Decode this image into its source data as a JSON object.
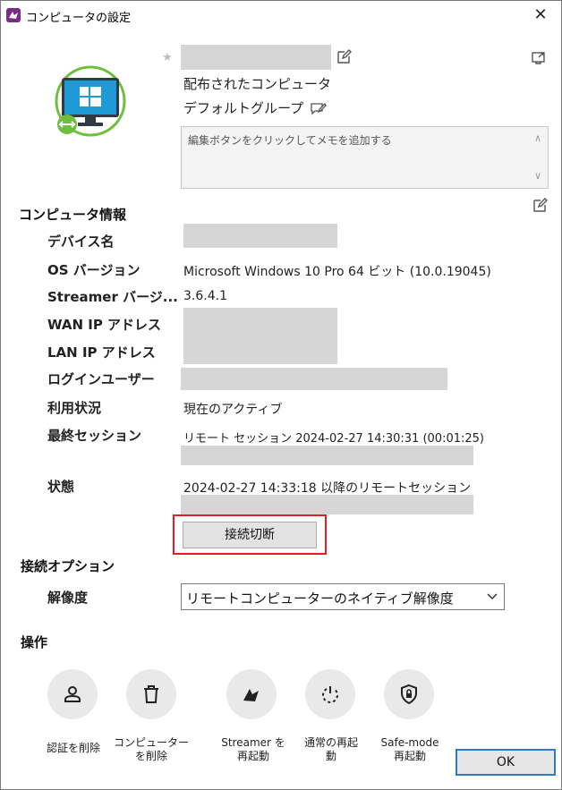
{
  "window": {
    "title": "コンピュータの設定",
    "close_glyph": "✕"
  },
  "header": {
    "star_glyph": "★",
    "distributed_label": "配布されたコンピュータ",
    "group_label": "デフォルトグループ"
  },
  "memo": {
    "placeholder": "編集ボタンをクリックしてメモを追加する",
    "scroll_up": "∧",
    "scroll_down": "∨"
  },
  "computer_info": {
    "heading": "コンピュータ情報",
    "device_name_label": "デバイス名",
    "os_version_label": "OS バージョン",
    "os_version_value": "Microsoft Windows 10 Pro 64 ビット (10.0.19045)",
    "streamer_version_label": "Streamer バージ...",
    "streamer_version_value": "3.6.4.1",
    "wan_ip_label": "WAN IP アドレス",
    "lan_ip_label": "LAN IP アドレス",
    "login_user_label": "ログインユーザー",
    "usage_label": "利用状況",
    "usage_value": "現在のアクティブ",
    "last_session_label": "最終セッション",
    "last_session_value": "リモート セッション 2024-02-27 14:30:31 (00:01:25)",
    "status_label": "状態",
    "status_value": "2024-02-27 14:33:18 以降のリモートセッション",
    "disconnect_button": "接続切断"
  },
  "connection_options": {
    "heading": "接続オプション",
    "resolution_label": "解像度",
    "resolution_value": "リモートコンピューターのネイティブ解像度"
  },
  "operations": {
    "heading": "操作",
    "remove_auth_label": "認証を削除",
    "delete_computer_label_1": "コンピューター",
    "delete_computer_label_2": "を削除",
    "restart_streamer_label_1": "Streamer を",
    "restart_streamer_label_2": "再起動",
    "normal_restart_label_1": "通常の再起",
    "normal_restart_label_2": "動",
    "safe_mode_label_1": "Safe-mode",
    "safe_mode_label_2": "再起動"
  },
  "footer": {
    "ok_button": "OK"
  },
  "colors": {
    "accent_blue": "#2c7bd1",
    "highlight_red": "#e02020",
    "redaction_gray": "#d6d6d6",
    "app_purple": "#7b2a86"
  }
}
